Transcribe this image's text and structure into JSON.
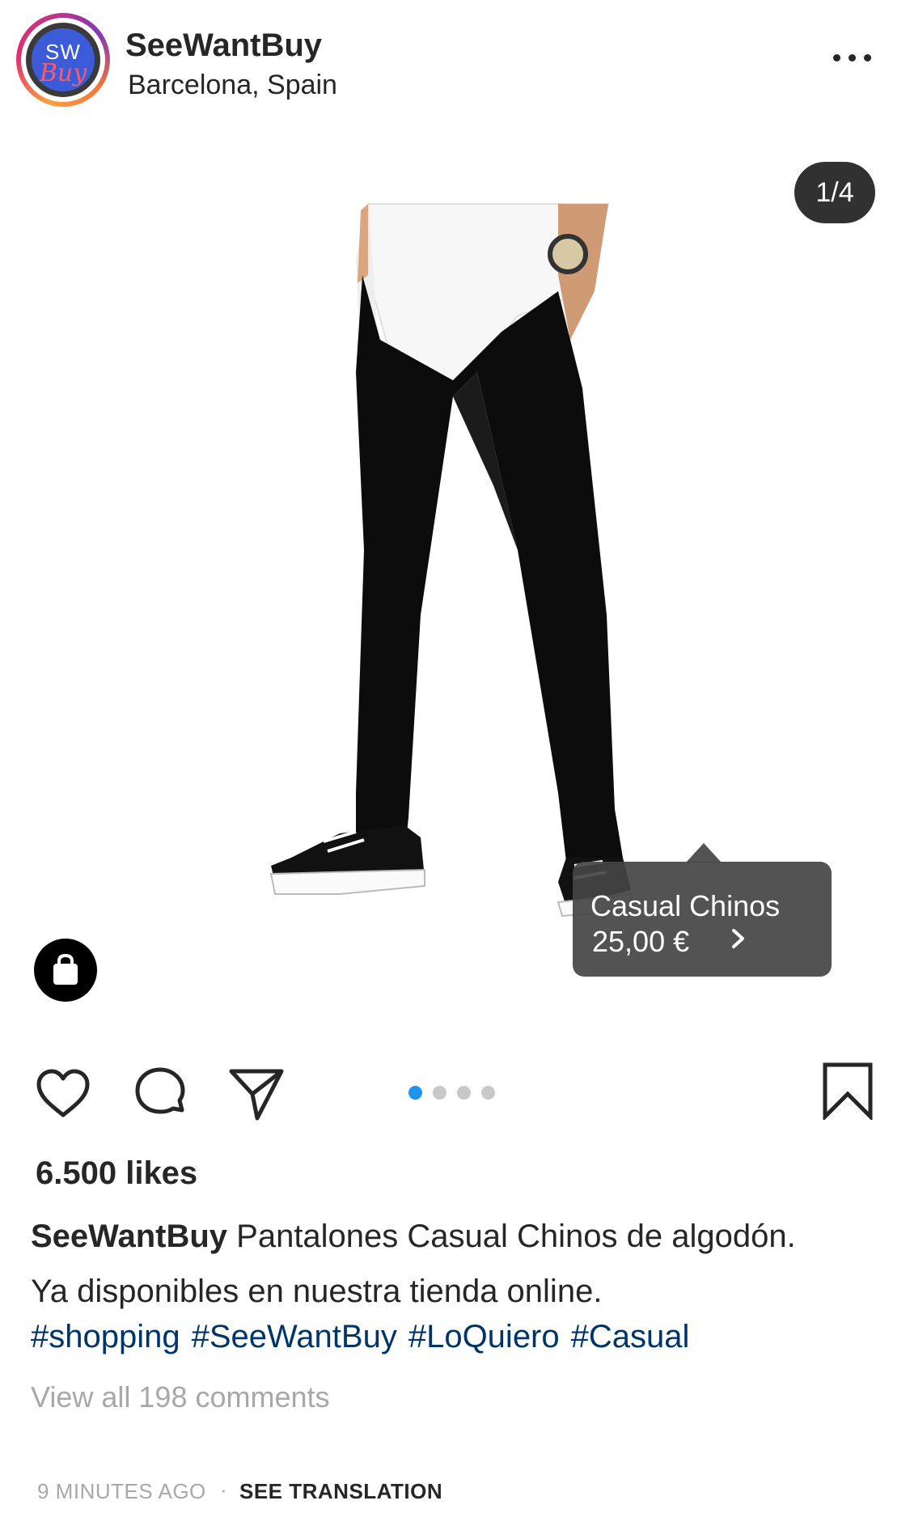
{
  "header": {
    "avatar_line1": "SW",
    "avatar_line2": "Buy",
    "username": "SeeWantBuy",
    "location": "Barcelona, Spain"
  },
  "media": {
    "counter": "1/4",
    "current_slide": 1,
    "total_slides": 4
  },
  "product_tag": {
    "name": "Casual Chinos",
    "price": "25,00 €"
  },
  "actions": {
    "like_icon": "heart-outline",
    "comment_icon": "speech-bubble",
    "share_icon": "paper-plane",
    "save_icon": "bookmark-outline",
    "active_dot_color": "#1e94f0"
  },
  "post": {
    "likes": "6.500 likes",
    "caption_user": "SeeWantBuy",
    "caption_line1": "Pantalones Casual Chinos de algodón.",
    "caption_line2": "Ya disponibles en nuestra tienda online.",
    "hashtags": [
      "#shopping",
      "#SeeWantBuy",
      "#LoQuiero",
      "#Casual"
    ],
    "comments_link": "View all 198 comments",
    "timestamp": "9 MINUTES AGO",
    "separator": "·",
    "see_translation": "SEE TRANSLATION"
  }
}
